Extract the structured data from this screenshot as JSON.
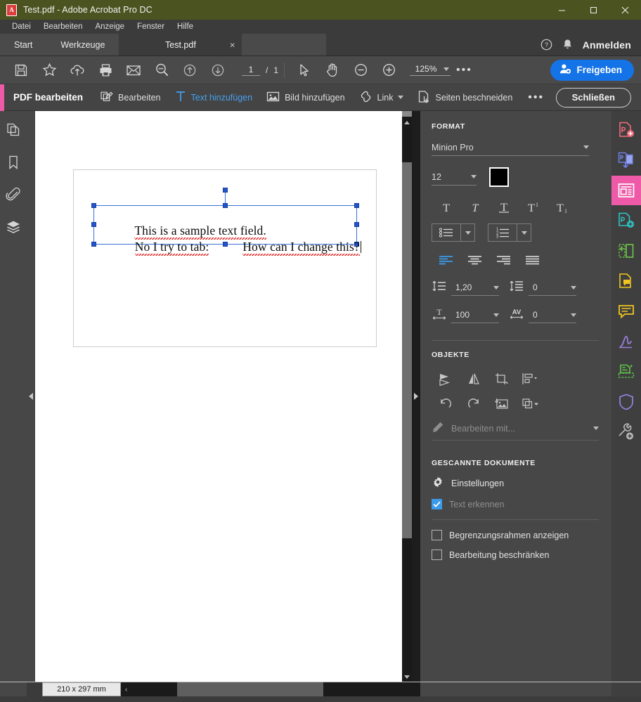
{
  "window": {
    "title": "Test.pdf - Adobe Acrobat Pro DC",
    "app_badge_letter": "A",
    "minimize_label": "Minimieren",
    "maximize_label": "Maximieren",
    "close_label": "Schließen"
  },
  "menubar": {
    "items": [
      {
        "label": "Datei"
      },
      {
        "label": "Bearbeiten"
      },
      {
        "label": "Anzeige"
      },
      {
        "label": "Fenster"
      },
      {
        "label": "Hilfe"
      }
    ]
  },
  "tabbar": {
    "nav_tabs": [
      {
        "label": "Start"
      },
      {
        "label": "Werkzeuge"
      }
    ],
    "document_tab": {
      "label": "Test.pdf",
      "close": "×"
    },
    "help_icon": "help-circle-icon",
    "bell_icon": "bell-icon",
    "signin_label": "Anmelden"
  },
  "toolbar": {
    "icons": [
      {
        "name": "save-icon"
      },
      {
        "name": "star-icon"
      },
      {
        "name": "cloud-upload-icon"
      },
      {
        "name": "print-icon"
      },
      {
        "name": "email-icon"
      },
      {
        "name": "search-icon"
      },
      {
        "name": "previous-page-icon"
      },
      {
        "name": "next-page-icon"
      }
    ],
    "page_current": "1",
    "page_separator": "/",
    "page_total": "1",
    "select_tool": "cursor-arrow-icon",
    "hand_tool": "hand-icon",
    "zoom_out": "zoom-out-icon",
    "zoom_in": "zoom-in-icon",
    "zoom_level": "125%",
    "more_label": "•••",
    "share_label": "Freigeben"
  },
  "subtoolbar": {
    "accent_color": "#ee5aa8",
    "title": "PDF bearbeiten",
    "items": [
      {
        "label": "Bearbeiten",
        "icon": "edit-pages-icon",
        "active": false
      },
      {
        "label": "Text hinzufügen",
        "icon": "add-text-icon",
        "active": true
      },
      {
        "label": "Bild hinzufügen",
        "icon": "add-image-icon",
        "active": false
      },
      {
        "label": "Link",
        "icon": "link-icon",
        "active": false,
        "has_dropdown": true
      },
      {
        "label": "Seiten beschneiden",
        "icon": "crop-pages-icon",
        "active": false
      }
    ],
    "more_label": "•••",
    "close_label": "Schließen"
  },
  "leftrail": {
    "items": [
      {
        "name": "page-thumbnails-icon"
      },
      {
        "name": "bookmarks-icon"
      },
      {
        "name": "attachments-icon"
      },
      {
        "name": "layers-icon"
      }
    ]
  },
  "document": {
    "text_lines": [
      {
        "id": "line1",
        "text": "This is a sample text field."
      },
      {
        "id": "line2a",
        "text": "No I try to tab:"
      },
      {
        "id": "line2b",
        "text": "How can I change this?"
      }
    ],
    "selection_color": "#2255cc",
    "spellcheck_color": "#e02020"
  },
  "rightpanel": {
    "format": {
      "title": "FORMAT",
      "font_family": "Minion Pro",
      "font_size": "12",
      "font_color": "#000000",
      "style_buttons": [
        {
          "name": "regular-text-icon",
          "glyph": "T"
        },
        {
          "name": "italic-text-icon",
          "glyph": "T"
        },
        {
          "name": "underline-text-icon",
          "glyph": "T"
        },
        {
          "name": "superscript-text-icon",
          "glyph": "T"
        },
        {
          "name": "subscript-text-icon",
          "glyph": "T"
        }
      ],
      "bullet_list": "bullet-list-icon",
      "numbered_list": "numbered-list-icon",
      "align_buttons": [
        {
          "name": "align-left-icon",
          "active": true
        },
        {
          "name": "align-center-icon",
          "active": false
        },
        {
          "name": "align-right-icon",
          "active": false
        },
        {
          "name": "align-justify-icon",
          "active": false
        }
      ],
      "line_spacing": "1,20",
      "paragraph_spacing": "0",
      "horizontal_scale": "100",
      "character_spacing": "0"
    },
    "objects": {
      "title": "OBJEKTE",
      "buttons": [
        {
          "name": "flip-vertical-icon"
        },
        {
          "name": "flip-horizontal-icon"
        },
        {
          "name": "crop-image-icon"
        },
        {
          "name": "align-objects-icon"
        },
        {
          "name": "rotate-counterclockwise-icon"
        },
        {
          "name": "rotate-clockwise-icon"
        },
        {
          "name": "replace-image-icon"
        },
        {
          "name": "arrange-objects-icon"
        }
      ],
      "edit_with_label": "Bearbeiten mit..."
    },
    "scanned": {
      "title": "GESCANNTE DOKUMENTE",
      "settings_label": "Einstellungen",
      "recognize_text_label": "Text erkennen",
      "recognize_text_checked": true,
      "show_bounding_boxes_label": "Begrenzungsrahmen anzeigen",
      "show_bounding_boxes_checked": false,
      "restrict_editing_label": "Bearbeitung beschränken",
      "restrict_editing_checked": false
    }
  },
  "toolrail": {
    "items": [
      {
        "name": "create-pdf-icon",
        "color": "#ef6b7a",
        "active": false
      },
      {
        "name": "export-pdf-icon",
        "color": "#6f7fe0",
        "active": false
      },
      {
        "name": "edit-pdf-icon",
        "color": "#ffffff",
        "active": true
      },
      {
        "name": "combine-files-icon",
        "color": "#2ec3c3",
        "active": false
      },
      {
        "name": "organize-pages-icon",
        "color": "#6ec64b",
        "active": false
      },
      {
        "name": "comment-document-icon",
        "color": "#f0c420",
        "active": false
      },
      {
        "name": "comment-icon",
        "color": "#f0c420",
        "active": false
      },
      {
        "name": "fill-and-sign-icon",
        "color": "#9b7ee0",
        "active": false
      },
      {
        "name": "scan-and-ocr-icon",
        "color": "#5fc24e",
        "active": false
      },
      {
        "name": "protect-icon",
        "color": "#8f86e0",
        "active": false
      },
      {
        "name": "more-tools-icon",
        "color": "#b9b9b9",
        "active": false
      }
    ]
  },
  "statusbar": {
    "page_size": "210 x 297 mm",
    "scroll_left_label": "‹"
  }
}
